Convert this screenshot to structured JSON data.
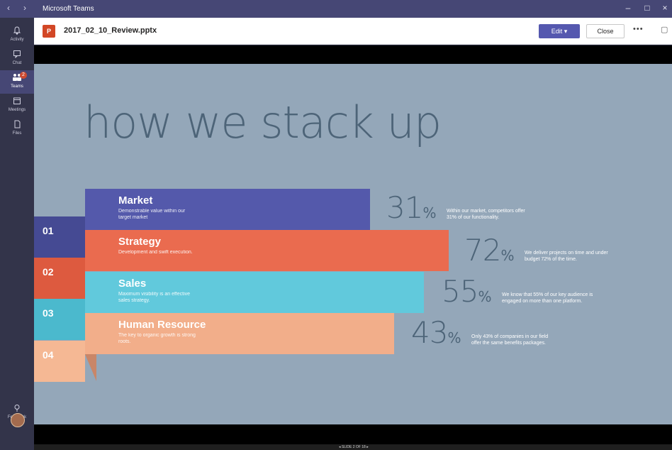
{
  "titlebar": {
    "back": "‹",
    "forward": "›",
    "title": "Microsoft Teams",
    "minimize": "–",
    "maximize": "□",
    "close": "×"
  },
  "rail": {
    "items": [
      {
        "label": "Activity",
        "icon": "bell-icon",
        "glyph": "🔔"
      },
      {
        "label": "Chat",
        "icon": "chat-icon",
        "glyph": "▭"
      },
      {
        "label": "Teams",
        "icon": "teams-icon",
        "glyph": "⁂",
        "badge": "2"
      },
      {
        "label": "Meetings",
        "icon": "calendar-icon",
        "glyph": "▤"
      },
      {
        "label": "Files",
        "icon": "file-icon",
        "glyph": "▯"
      }
    ],
    "feedback": {
      "label": "Feedback",
      "glyph": "♀"
    }
  },
  "filebar": {
    "icon_letter": "P",
    "filename": "2017_02_10_Review.pptx",
    "edit_label": "Edit ▾",
    "close_label": "Close",
    "more": "•••",
    "chat_icon": "▢"
  },
  "slide": {
    "title": "how we stack up",
    "rows": [
      {
        "num": "01",
        "heading": "Market",
        "sub": "Demonstrable value within our target market",
        "value": "31",
        "desc": "Within our market, competitors offer 31% of our functionality.",
        "band_color": "#5459ab",
        "tab_color": "#5459ab"
      },
      {
        "num": "02",
        "heading": "Strategy",
        "sub": "Development and swift execution.",
        "value": "72",
        "desc": "We deliver projects on time and under budget 72% of the time.",
        "band_color": "#ea6b4f",
        "tab_color": "#ea6b4f"
      },
      {
        "num": "03",
        "heading": "Sales",
        "sub": "Maximum visibility is an effective sales strategy.",
        "value": "55",
        "desc": "We know that 55% of our key audience is engaged on more than one platform.",
        "band_color": "#61c9dc",
        "tab_color": "#61c9dc"
      },
      {
        "num": "04",
        "heading": "Human Resource",
        "sub": "The key to organic growth is strong roots.",
        "value": "43",
        "desc": "Only 43% of companies in our field offer the same benefits packages.",
        "band_color": "#f2ae8a",
        "tab_color": "#f2ae8a"
      }
    ],
    "percent_sign": "%"
  },
  "status": {
    "slide_counter": "◂ SLIDE 2 OF 18 ▸"
  }
}
